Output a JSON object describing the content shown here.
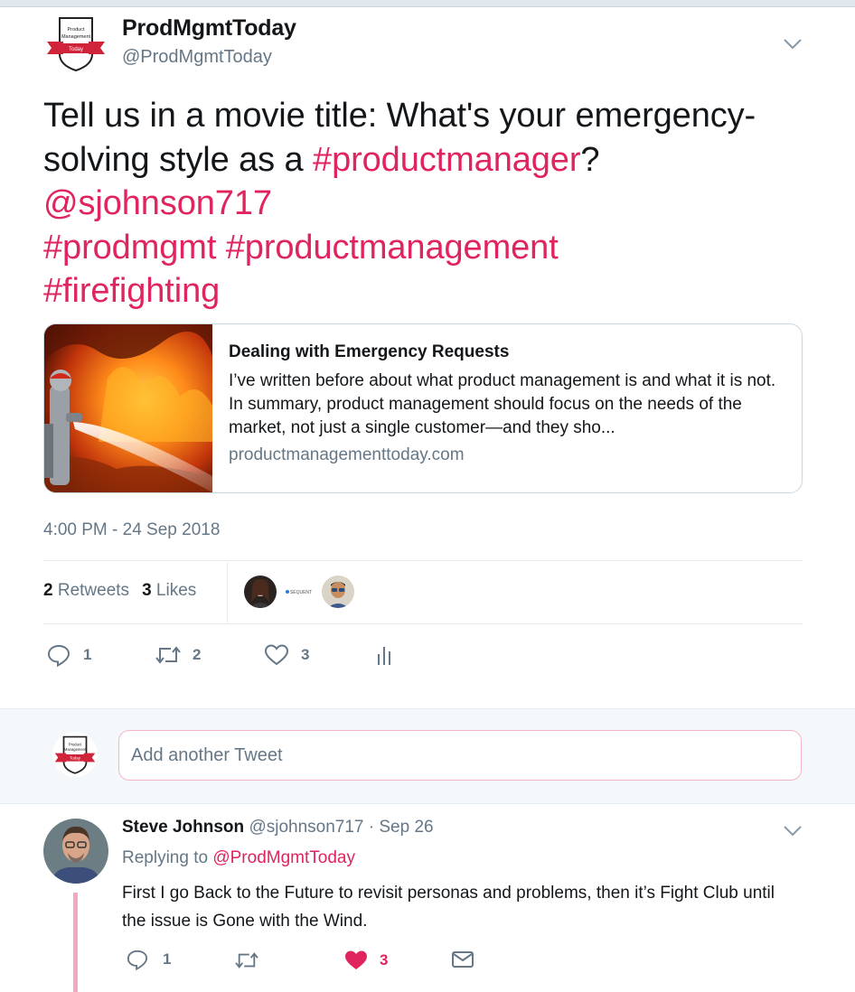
{
  "tweet": {
    "author_name": "ProdMgmtToday",
    "author_handle": "@ProdMgmtToday",
    "text_plain_1": "Tell us in a movie title: What's your emergency-solving style as a ",
    "hashtag_productmanager": "#productmanager",
    "text_plain_2": "? ",
    "mention_sjohnson": "@sjohnson717",
    "hashtag_prodmgmt": "#prodmgmt",
    "hashtag_productmanagement": "#productmanagement",
    "hashtag_firefighting": "#firefighting",
    "timestamp": "4:00 PM - 24 Sep 2018"
  },
  "card": {
    "title": "Dealing with Emergency Requests",
    "description": "I’ve written before about what product management is and what it is not. In summary, product management should focus on the needs of the market, not just a single customer—and they sho...",
    "domain": "productmanagementtoday.com",
    "image": "firefighter-spraying-fire"
  },
  "stats": {
    "retweets_count": "2",
    "retweets_label": "Retweets",
    "likes_count": "3",
    "likes_label": "Likes",
    "sequent_text": "SEQUENT"
  },
  "actions": {
    "reply_count": "1",
    "retweet_count": "2",
    "like_count": "3"
  },
  "composer": {
    "placeholder": "Add another Tweet"
  },
  "reply": {
    "author_name": "Steve Johnson",
    "author_handle": "@sjohnson717",
    "time": "· Sep 26",
    "replying_label": "Replying to",
    "replying_to": "@ProdMgmtToday",
    "text": "First I go Back to the Future to revisit personas and problems, then it’s Fight Club until the issue is Gone with the Wind.",
    "reply_count": "1",
    "like_count": "3"
  },
  "logo": {
    "line1": "Product",
    "line2": "Management",
    "line3": "Today"
  },
  "colors": {
    "accent": "#e0245e",
    "muted": "#657786",
    "text": "#14171a"
  }
}
